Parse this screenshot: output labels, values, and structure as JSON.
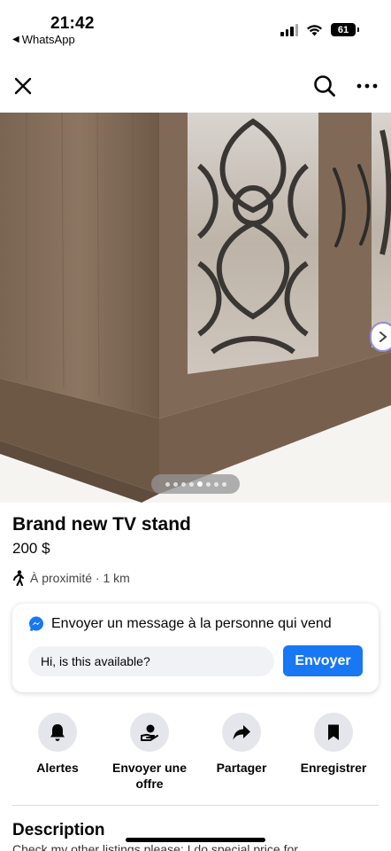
{
  "status_bar": {
    "time": "21:42",
    "back_app": "WhatsApp",
    "battery": "61"
  },
  "nav": {
    "close_icon": "close-icon",
    "search_icon": "search-icon",
    "more_icon": "more-icon"
  },
  "gallery": {
    "image_count": 8,
    "active_index": 4
  },
  "listing": {
    "title": "Brand new TV stand",
    "price": "200 $",
    "location": "À proximité · 1 km"
  },
  "message": {
    "heading": "Envoyer un message à la personne qui vend",
    "input_value": "Hi, is this available?",
    "send_label": "Envoyer"
  },
  "actions": [
    {
      "label": "Alertes",
      "icon": "bell-icon"
    },
    {
      "label": "Envoyer une offre",
      "icon": "offer-icon"
    },
    {
      "label": "Partager",
      "icon": "share-icon"
    },
    {
      "label": "Enregistrer",
      "icon": "bookmark-icon"
    }
  ],
  "description": {
    "title": "Description",
    "text": "Check my other listings please: I do special price for"
  },
  "colors": {
    "accent": "#1877f2",
    "button_bg": "#e4e6eb"
  }
}
